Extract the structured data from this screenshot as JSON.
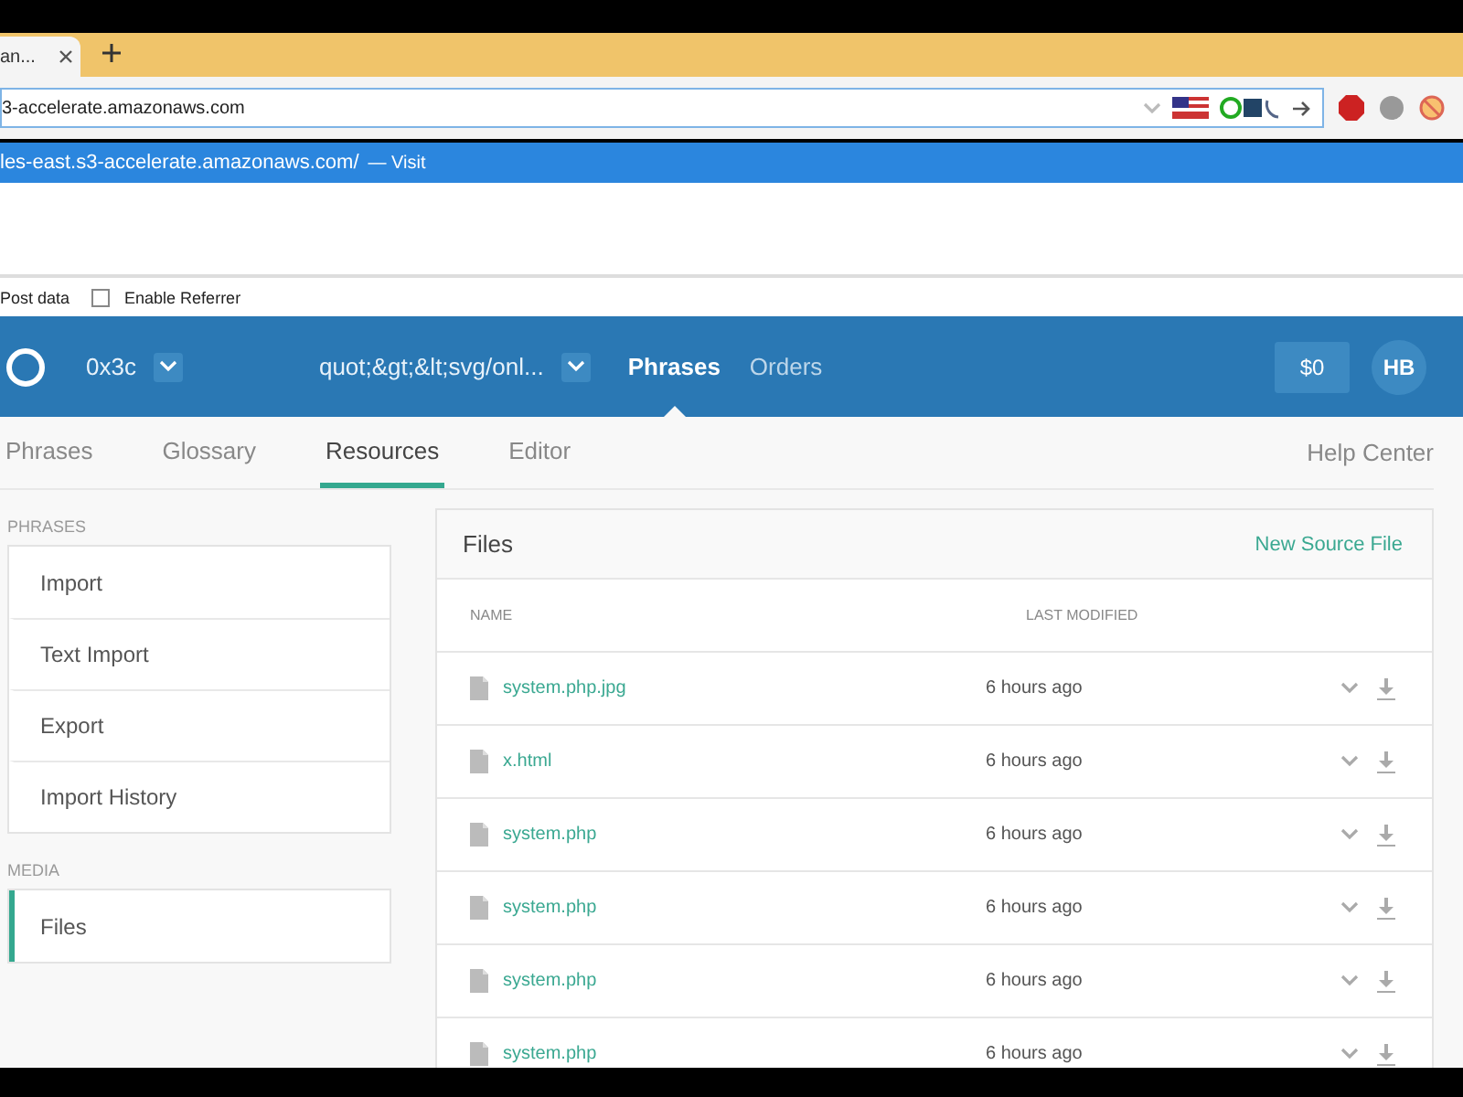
{
  "browser": {
    "tabs": [
      {
        "title": "an...",
        "selected": true
      }
    ],
    "address": "3-accelerate.amazonaws.com",
    "suggestion": {
      "url": "les-east.s3-accelerate.amazonaws.com/",
      "action": "— Visit"
    }
  },
  "devbar": {
    "post_label": "Post data",
    "referrer": {
      "label": "Enable Referrer",
      "checked": false
    }
  },
  "header": {
    "project": "0x3c",
    "locale": "quot;&gt;&lt;svg/onl...",
    "nav": [
      {
        "label": "Phrases",
        "selected": true
      },
      {
        "label": "Orders",
        "selected": false
      }
    ],
    "balance": "$0",
    "avatar": "HB"
  },
  "subnav": {
    "tabs": [
      {
        "label": "Phrases",
        "selected": false
      },
      {
        "label": "Glossary",
        "selected": false
      },
      {
        "label": "Resources",
        "selected": true
      },
      {
        "label": "Editor",
        "selected": false
      }
    ],
    "help": "Help Center"
  },
  "sidebar": {
    "sections": [
      {
        "title": "PHRASES",
        "items": [
          {
            "label": "Import",
            "selected": false
          },
          {
            "label": "Text Import",
            "selected": false
          },
          {
            "label": "Export",
            "selected": false
          },
          {
            "label": "Import History",
            "selected": false
          }
        ]
      },
      {
        "title": "MEDIA",
        "items": [
          {
            "label": "Files",
            "selected": true
          }
        ]
      }
    ]
  },
  "files": {
    "title": "Files",
    "action": "New Source File",
    "columns": [
      "NAME",
      "LAST MODIFIED"
    ],
    "rows": [
      {
        "name": "system.php.jpg",
        "modified": "6 hours ago"
      },
      {
        "name": "x.html",
        "modified": "6 hours ago"
      },
      {
        "name": "system.php",
        "modified": "6 hours ago"
      },
      {
        "name": "system.php",
        "modified": "6 hours ago"
      },
      {
        "name": "system.php",
        "modified": "6 hours ago"
      },
      {
        "name": "system.php",
        "modified": "6 hours ago"
      }
    ]
  }
}
